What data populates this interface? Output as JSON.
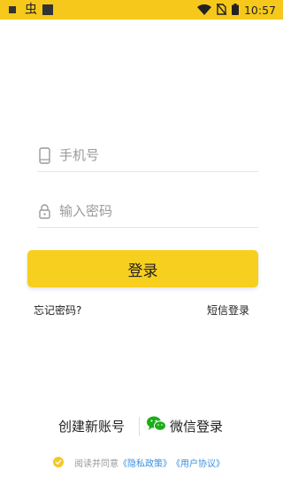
{
  "status_bar": {
    "app_glyph": "虫",
    "time": "10:57"
  },
  "login_form": {
    "phone_placeholder": "手机号",
    "password_placeholder": "输入密码",
    "login_button": "登录",
    "forgot_password": "忘记密码?",
    "sms_login": "短信登录"
  },
  "bottom": {
    "create_account": "创建新账号",
    "wechat_login": "微信登录"
  },
  "agreement": {
    "prefix": "阅读并同意",
    "privacy_policy": "《隐私政策》",
    "user_agreement": "《用户协议》"
  },
  "colors": {
    "brand_yellow": "#f7cf1f",
    "link_blue": "#3b8fe0",
    "wechat_green": "#1aad19"
  },
  "icons": {
    "status_left": [
      "notification-square-icon",
      "app-glyph-icon",
      "notification-square-icon"
    ],
    "status_right": [
      "wifi-icon",
      "sim-off-icon",
      "battery-icon"
    ],
    "phone_field": "smartphone-icon",
    "password_field": "lock-icon",
    "wechat": "wechat-icon",
    "agreement": "check-circle-icon"
  }
}
